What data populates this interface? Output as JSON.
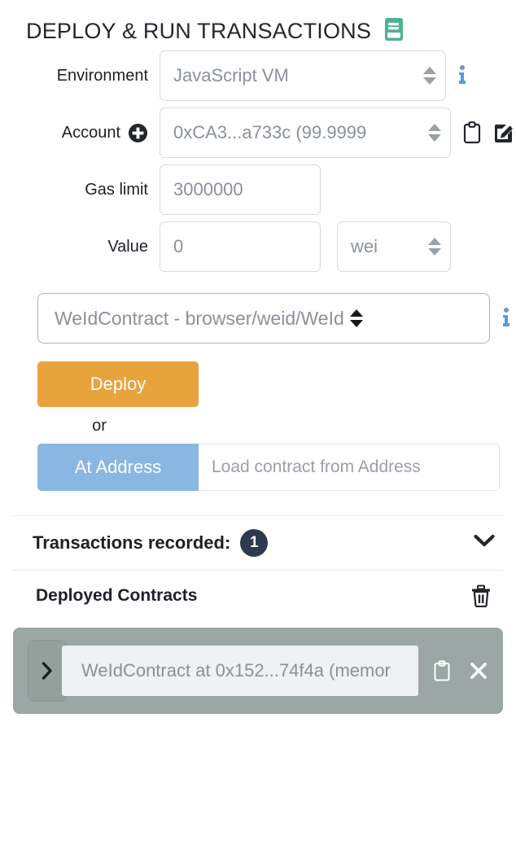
{
  "header": {
    "title": "DEPLOY & RUN TRANSACTIONS",
    "journal_icon": "journal-book-icon"
  },
  "form": {
    "environment": {
      "label": "Environment",
      "value": "JavaScript VM",
      "info_icon": "info-icon",
      "control": "select"
    },
    "account": {
      "label": "Account",
      "value": "0xCA3...a733c (99.9999",
      "plus_icon": "plus-circle-icon",
      "copy_icon": "clipboard-icon",
      "edit_icon": "pencil-square-icon",
      "control": "select"
    },
    "gas_limit": {
      "label": "Gas limit",
      "value": "3000000",
      "control": "input"
    },
    "value": {
      "label": "Value",
      "value": "0",
      "unit": "wei",
      "control": "input"
    }
  },
  "contract": {
    "selected": "WeIdContract - browser/weid/WeId",
    "info_icon": "info-icon"
  },
  "actions": {
    "deploy_label": "Deploy",
    "or_label": "or",
    "at_address_label": "At Address",
    "at_address_placeholder": "Load contract from Address"
  },
  "transactions": {
    "label": "Transactions recorded:",
    "count": "1",
    "chevron_icon": "chevron-down-icon"
  },
  "deployed": {
    "title": "Deployed Contracts",
    "trash_icon": "trash-icon",
    "instances": [
      {
        "name": "WeIdContract at 0x152...74f4a (memor",
        "expand_icon": "chevron-right-icon",
        "copy_icon": "clipboard-icon",
        "close_icon": "close-x-icon"
      }
    ]
  },
  "colors": {
    "deploy_button": "#e8a33d",
    "at_address_button": "#8ab6e2",
    "journal_icon": "#4cb391",
    "info_icon": "#5a9bd8",
    "badge": "#2d3a4e",
    "instance_background": "#9aa7a4"
  }
}
